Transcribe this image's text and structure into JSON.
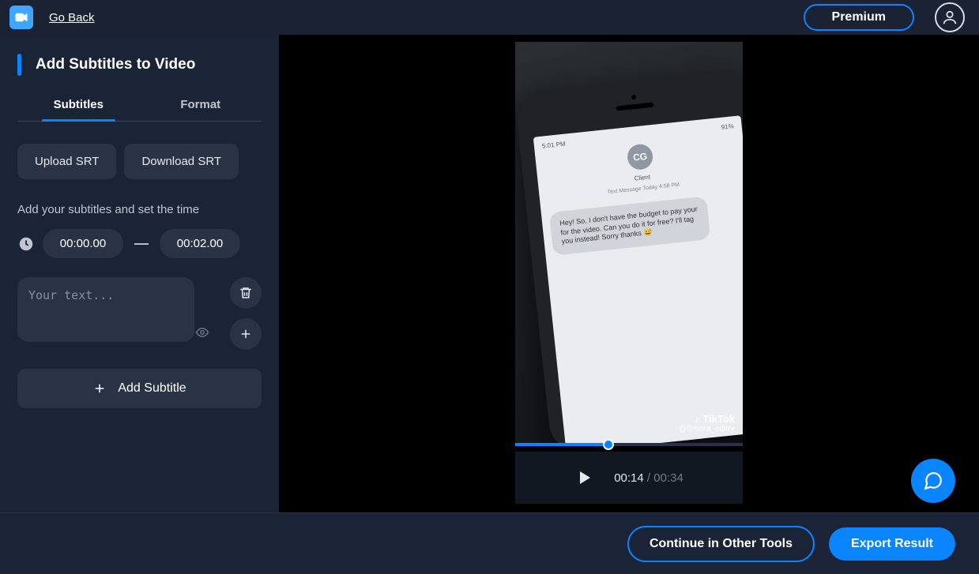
{
  "header": {
    "go_back": "Go Back",
    "premium": "Premium"
  },
  "sidebar": {
    "title": "Add Subtitles to Video",
    "tabs": {
      "subtitles": "Subtitles",
      "format": "Format"
    },
    "upload_srt": "Upload SRT",
    "download_srt": "Download SRT",
    "instruction": "Add your subtitles and set the time",
    "time_start": "00:00.00",
    "time_dash": "—",
    "time_end": "00:02.00",
    "text_placeholder": "Your text...",
    "add_subtitle": "Add Subtitle"
  },
  "preview": {
    "phone": {
      "status_time": "5:01 PM",
      "status_right": "91%",
      "initials": "CG",
      "client_label": "Client",
      "meta": "Text Message\nToday 4:58 PM",
      "bubble": "Hey! So, I don't have the budget to pay your for the video. Can you do it for free? I'll tag you instead! Sorry thanks 😅"
    },
    "watermark": {
      "brand": "TikTok",
      "handle": "@filmora_editor"
    },
    "time_current": "00:14",
    "time_sep": " / ",
    "time_total": "00:34"
  },
  "footer": {
    "continue": "Continue in Other Tools",
    "export": "Export Result"
  },
  "icons": {
    "logo": "video-logo-icon",
    "avatar": "user-avatar-icon",
    "clock": "clock-icon",
    "trash": "trash-icon",
    "plus": "plus-icon",
    "eye": "visibility-icon",
    "play": "play-icon",
    "help": "chat-help-icon",
    "tiktok": "tiktok-icon"
  }
}
